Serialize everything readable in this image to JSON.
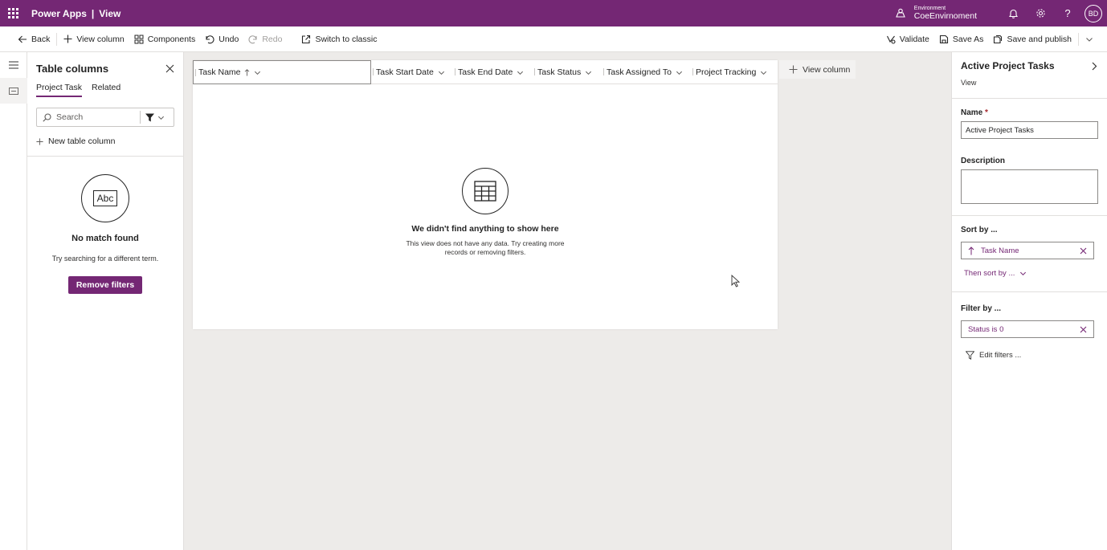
{
  "topbar": {
    "app_name": "Power Apps",
    "separator": "|",
    "page_name": "View",
    "environment_label": "Environment",
    "environment_name": "CoeEnvirnoment",
    "avatar_initials": "BD"
  },
  "cmdbar": {
    "back": "Back",
    "view_column": "View column",
    "components": "Components",
    "undo": "Undo",
    "redo": "Redo",
    "switch_classic": "Switch to classic",
    "validate": "Validate",
    "save_as": "Save As",
    "save_publish": "Save and publish"
  },
  "column_panel": {
    "title": "Table columns",
    "tabs": [
      "Project Task",
      "Related"
    ],
    "active_tab": "Project Task",
    "search_placeholder": "Search",
    "new_column": "New table column",
    "nomatch_icon_text": "Abc",
    "nomatch_title": "No match found",
    "nomatch_hint": "Try searching for a different term.",
    "remove_filters": "Remove filters"
  },
  "grid": {
    "columns": [
      {
        "label": "Task Name",
        "sort": "ascending"
      },
      {
        "label": "Task Start Date"
      },
      {
        "label": "Task End Date"
      },
      {
        "label": "Task Status"
      },
      {
        "label": "Task Assigned To"
      },
      {
        "label": "Project Tracking"
      }
    ],
    "empty_title": "We didn't find anything to show here",
    "empty_desc": "This view does not have any data. Try creating more records or removing filters.",
    "add_column": "View column"
  },
  "right_panel": {
    "title": "Active Project Tasks",
    "subtitle": "View",
    "name_label": "Name",
    "name_required": "*",
    "name_value": "Active Project Tasks",
    "description_label": "Description",
    "description_value": "",
    "sort_label": "Sort by ...",
    "sort_chip": "Task Name",
    "then_sort": "Then sort by ...",
    "filter_label": "Filter by ...",
    "filter_chip": "Status is 0",
    "edit_filters": "Edit filters ..."
  },
  "colors": {
    "brand": "#742774",
    "canvas": "#edebe9"
  }
}
